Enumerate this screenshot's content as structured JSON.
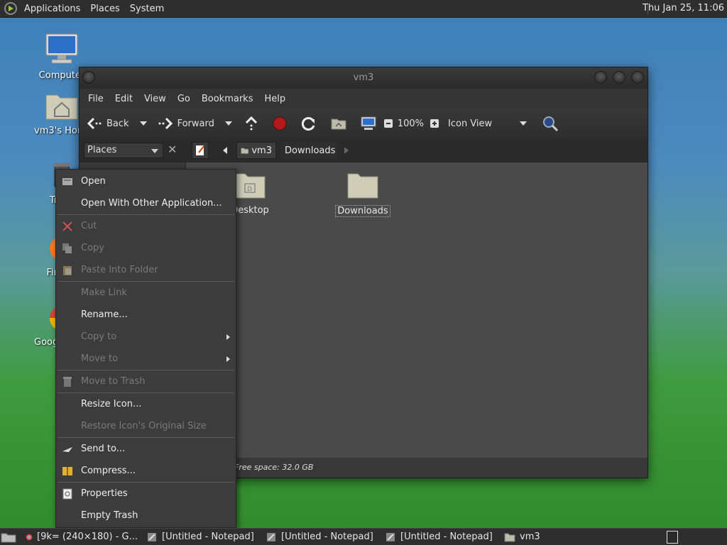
{
  "top_panel": {
    "menus": [
      "Applications",
      "Places",
      "System"
    ],
    "clock": "Thu Jan 25, 11:06"
  },
  "desktop_icons": {
    "computer": "Computer",
    "home": "vm3's Home",
    "trash": "Trash",
    "firefox": "Firefox",
    "chrome": "Google Chrome"
  },
  "window": {
    "title": "vm3",
    "menu": [
      "File",
      "Edit",
      "View",
      "Go",
      "Bookmarks",
      "Help"
    ],
    "toolbar": {
      "back": "Back",
      "forward": "Forward",
      "zoom": "100%",
      "view_mode": "Icon View"
    },
    "sidebar_combo": "Places",
    "breadcrumbs": [
      "vm3",
      "Downloads"
    ],
    "files": [
      "Desktop",
      "Downloads"
    ],
    "status": "Free space: 32.0 GB"
  },
  "context_menu": {
    "items": [
      {
        "label": "Open",
        "enabled": true
      },
      {
        "label": "Open With Other Application...",
        "enabled": true
      },
      {
        "label": "Cut",
        "enabled": false
      },
      {
        "label": "Copy",
        "enabled": false
      },
      {
        "label": "Paste Into Folder",
        "enabled": false
      },
      {
        "label": "Make Link",
        "enabled": false
      },
      {
        "label": "Rename...",
        "enabled": true
      },
      {
        "label": "Copy to",
        "enabled": false
      },
      {
        "label": "Move to",
        "enabled": false
      },
      {
        "label": "Move to Trash",
        "enabled": false
      },
      {
        "label": "Resize Icon...",
        "enabled": true
      },
      {
        "label": "Restore Icon's Original Size",
        "enabled": false
      },
      {
        "label": "Send to...",
        "enabled": true
      },
      {
        "label": "Compress...",
        "enabled": true
      },
      {
        "label": "Properties",
        "enabled": true
      },
      {
        "label": "Empty Trash",
        "enabled": true
      }
    ]
  },
  "taskbar": {
    "tasks": [
      "[9k= (240×180) - G...",
      "[Untitled - Notepad]",
      "[Untitled - Notepad]",
      "[Untitled - Notepad]",
      "vm3"
    ]
  }
}
